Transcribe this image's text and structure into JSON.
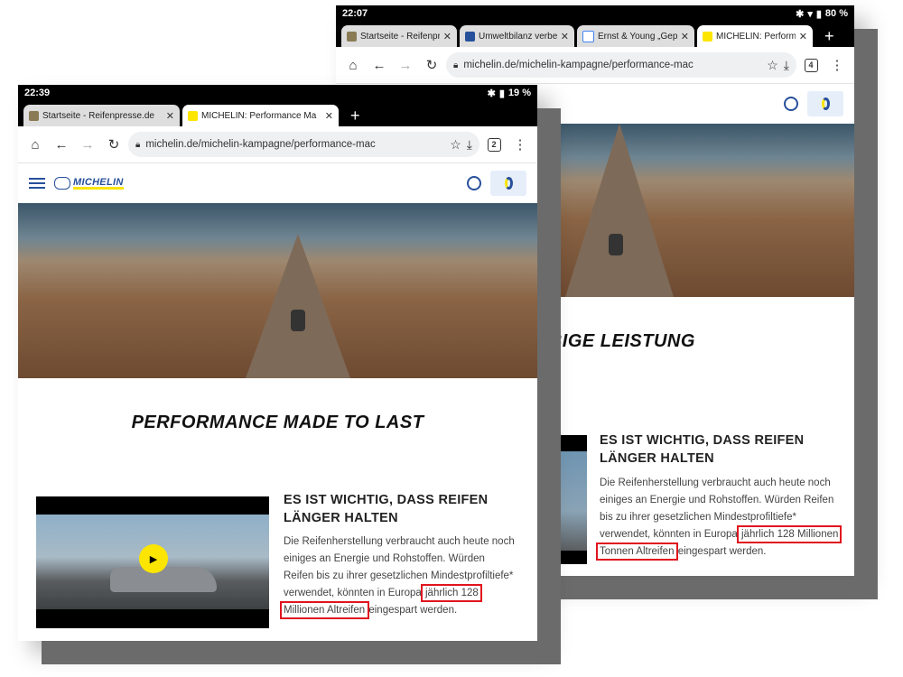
{
  "back": {
    "status": {
      "time": "22:07",
      "battery": "80 %"
    },
    "tabs": [
      {
        "title": "Startseite - Reifenpr",
        "fav_color": "#8a7b55"
      },
      {
        "title": "Umweltbilanz verbe",
        "fav_color": "#27509b"
      },
      {
        "title": "Ernst & Young „Gep",
        "fav_color": "#4285f4"
      },
      {
        "title": "MICHELIN: Performa",
        "fav_color": "#fce500",
        "active": true
      }
    ],
    "url": "michelin.de/michelin-kampagne/performance-mac",
    "tab_count": "4",
    "headline": "EBIGE LEISTUNG",
    "subheading": "ES IST WICHTIG, DASS REIFEN LÄNGER HALTEN",
    "para_before": "Die Reifenherstellung verbraucht auch heute noch einiges an Energie und Rohstoffen. Würden Reifen bis zu ihrer gesetzlichen Mindestprofiltiefe* verwendet, könnten in Europa",
    "highlight": "jährlich 128 Millionen Tonnen Altreifen",
    "para_after": "eingespart werden."
  },
  "front": {
    "status": {
      "time": "22:39",
      "battery": "19 %"
    },
    "tabs": [
      {
        "title": "Startseite - Reifenpresse.de",
        "fav_color": "#8a7b55"
      },
      {
        "title": "MICHELIN: Performance Ma",
        "fav_color": "#fce500",
        "active": true
      }
    ],
    "url": "michelin.de/michelin-kampagne/performance-mac",
    "tab_count": "2",
    "logo": "MICHELIN",
    "headline": "PERFORMANCE MADE TO LAST",
    "subheading": "ES IST WICHTIG, DASS REIFEN LÄNGER HALTEN",
    "para_before": "Die Reifenherstellung verbraucht auch heute noch einiges an Energie und Rohstoffen. Würden Reifen bis zu ihrer gesetzlichen Mindestprofiltiefe* verwendet, könnten in Europa",
    "highlight": "jährlich 128 Millionen Altreifen",
    "para_after": "eingespart werden."
  },
  "icons": {
    "close": "✕",
    "new_tab": "+",
    "home": "⌂",
    "back": "←",
    "forward": "→",
    "reload": "↻",
    "star": "☆",
    "download": "⤓",
    "menu": "⋮",
    "play": "▶"
  },
  "colors": {
    "brand_blue": "#27509b",
    "brand_yellow": "#fce500",
    "highlight_red": "#e0141e"
  }
}
